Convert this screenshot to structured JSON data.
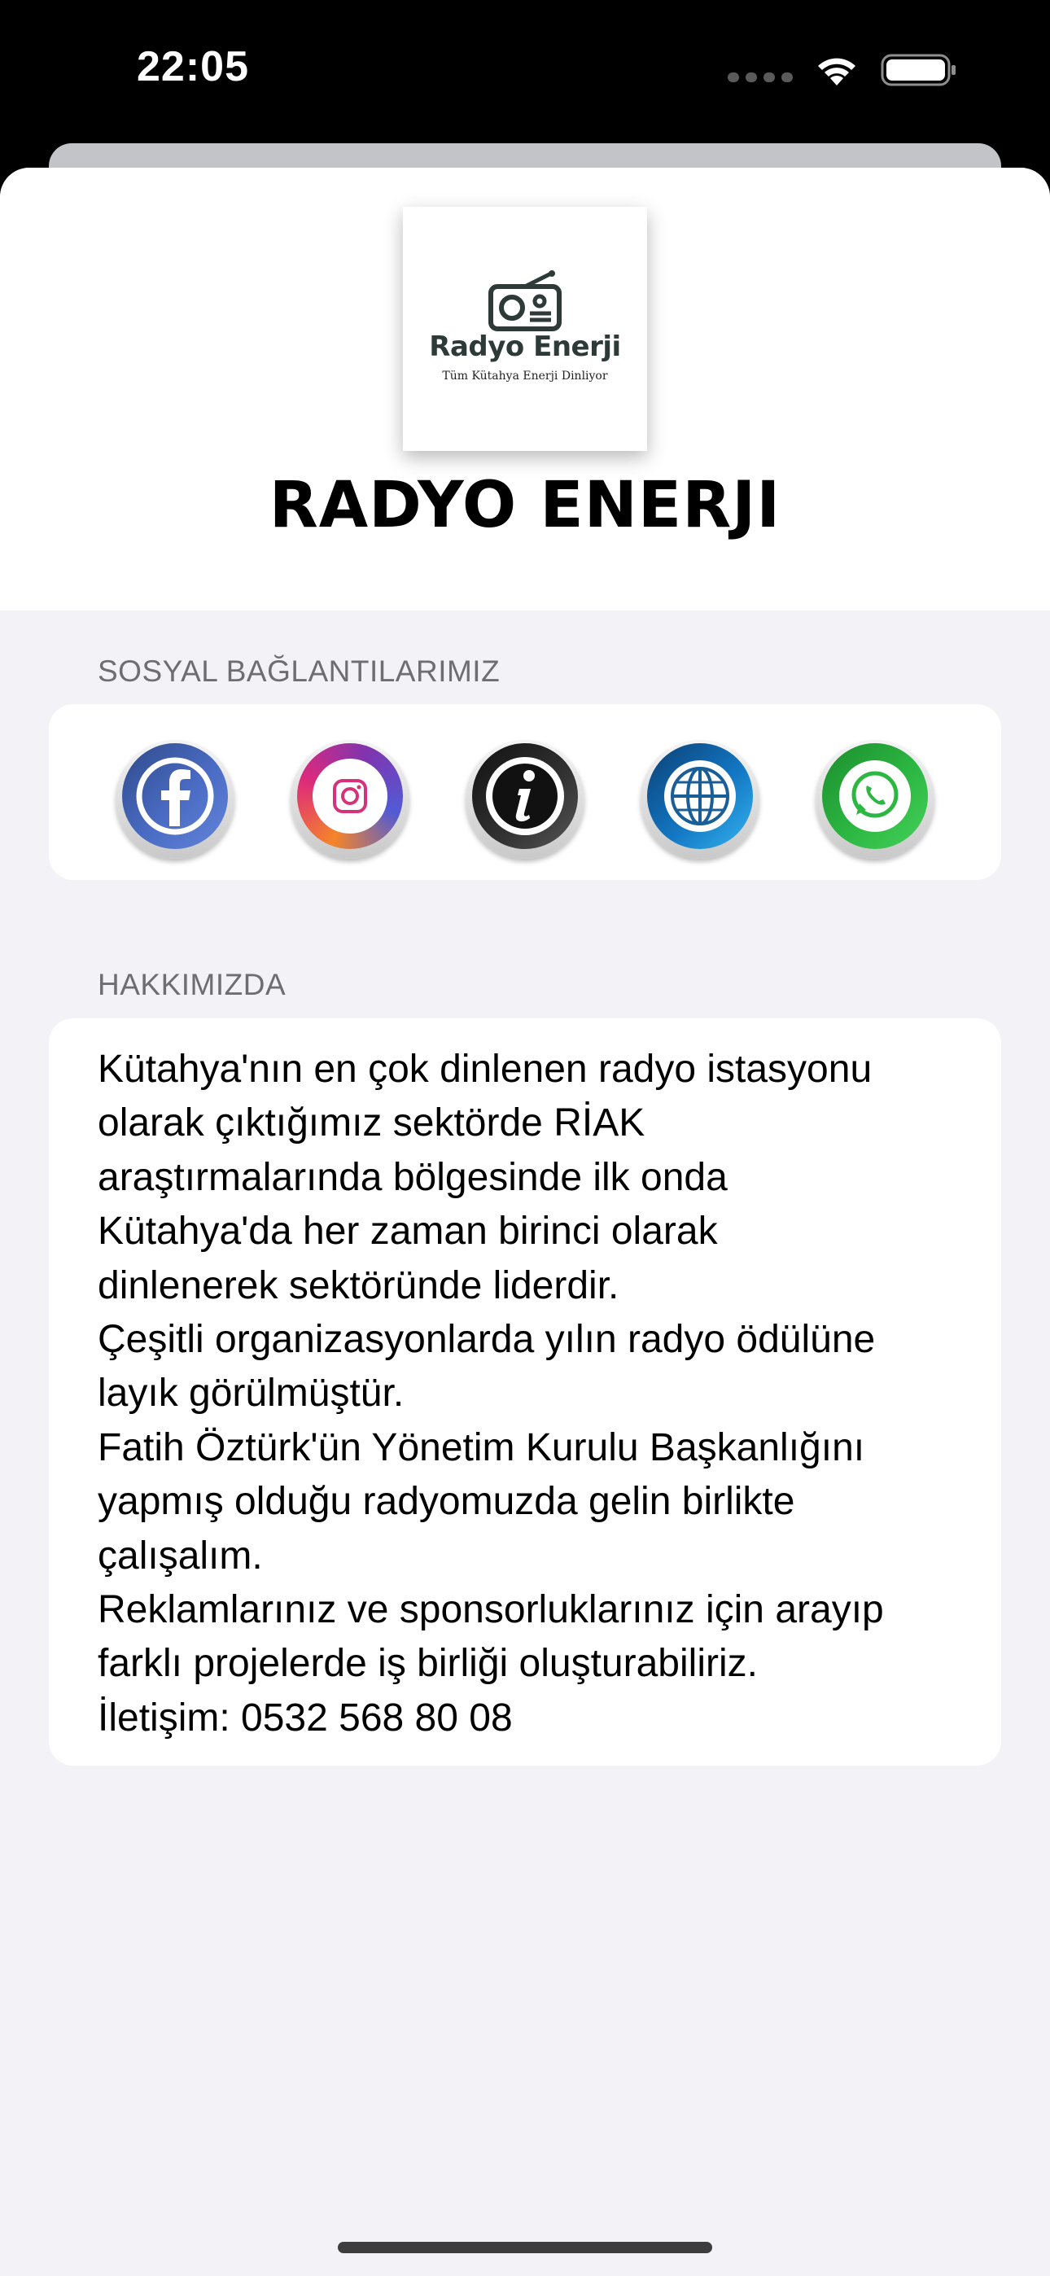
{
  "status_bar": {
    "time": "22:05"
  },
  "header": {
    "logo_name": "Radyo Enerji",
    "logo_tagline": "Tüm Kütahya Enerji Dinliyor",
    "station_title": "RADYO ENERJI"
  },
  "social": {
    "section_title": "SOSYAL BAĞLANTILARIMIZ",
    "buttons": [
      {
        "icon": "facebook-icon",
        "color": "#3b5998"
      },
      {
        "icon": "instagram-icon",
        "color": "#dd2a7b"
      },
      {
        "icon": "info-icon",
        "color": "#1a1a1a"
      },
      {
        "icon": "globe-icon",
        "color": "#1276c2"
      },
      {
        "icon": "whatsapp-icon",
        "color": "#25d366"
      }
    ]
  },
  "about": {
    "section_title": "HAKKIMIZDA",
    "text": "Kütahya'nın en çok dinlenen radyo istasyonu\nolarak çıktığımız sektörde RİAK\naraştırmalarında bölgesinde ilk onda\nKütahya'da her zaman birinci olarak\ndinlenerek sektöründe liderdir.\nÇeşitli organizasyonlarda yılın radyo ödülüne\nlayık görülmüştür.\nFatih Öztürk'ün Yönetim Kurulu Başkanlığını\nyapmış olduğu radyomuzda gelin birlikte\nçalışalım.\nReklamlarınız ve sponsorluklarınız için arayıp\nfarklı projelerde iş birliği oluşturabiliriz.\nİletişim: 0532 568 80 08"
  },
  "colors": {
    "background": "#f2f2f7",
    "card": "#ffffff",
    "section_header": "#6d6d72"
  }
}
